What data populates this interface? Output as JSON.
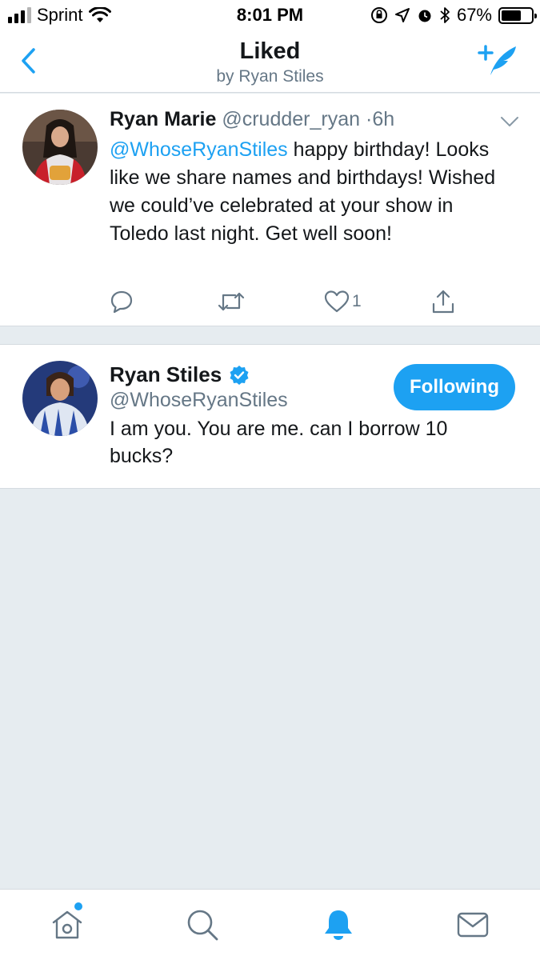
{
  "status_bar": {
    "carrier": "Sprint",
    "time": "8:01 PM",
    "battery_percent": "67%",
    "battery_level": 0.67,
    "signal_bars_active": 3,
    "signal_bars_total": 4
  },
  "header": {
    "title": "Liked",
    "subtitle": "by Ryan Stiles"
  },
  "tweet": {
    "name": "Ryan Marie",
    "handle": "@crudder_ryan",
    "separator": "·",
    "time": "6h",
    "mention": "@WhoseRyanStiles",
    "text": " happy birthday! Looks like we share names and birthdays! Wished we could’ve celebrated at your show in Toledo last night. Get well soon!",
    "like_count": "1"
  },
  "user": {
    "name": "Ryan Stiles",
    "handle": "@WhoseRyanStiles",
    "bio": "I am you. You are me. can I borrow 10 bucks?",
    "follow_label": "Following",
    "verified": true
  },
  "tabs": [
    {
      "icon": "home-icon",
      "has_notification_dot": true
    },
    {
      "icon": "search-icon"
    },
    {
      "icon": "bell-icon",
      "active": true
    },
    {
      "icon": "mail-icon"
    }
  ],
  "colors": {
    "accent": "#1da1f2",
    "text": "#14171a",
    "secondary_text": "#657786",
    "background": "#e6ecf0"
  }
}
